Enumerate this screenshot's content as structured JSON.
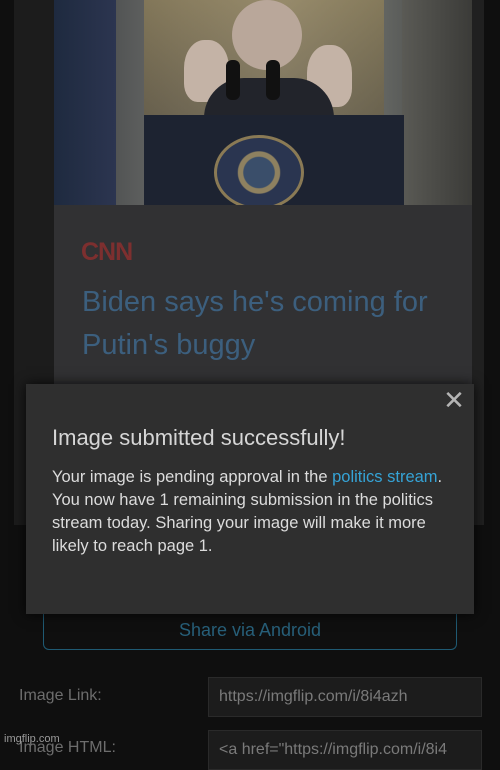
{
  "article": {
    "brand": "CNN",
    "headline": "Biden says he's coming for Putin's buggy"
  },
  "watermark": "im",
  "modal": {
    "title": "Image submitted successfully!",
    "body_prefix": "Your image is pending approval in the ",
    "link_text": "politics stream",
    "body_suffix": ". You now have 1 remaining submission in the politics stream today. Sharing your image will make it more likely to reach page 1.",
    "close_label": "✕"
  },
  "share": {
    "label": "Share via Android"
  },
  "links": {
    "image_link_label": "Image Link:",
    "image_link_value": "https://imgflip.com/i/8i4azh",
    "image_html_label": "Image HTML:",
    "image_html_value": "<a href=\"https://imgflip.com/i/8i4"
  },
  "footer_watermark": "imgflip.com",
  "colors": {
    "link": "#35a3d6",
    "brand_red": "#7d2f2f",
    "headline": "#3c5f7e"
  }
}
